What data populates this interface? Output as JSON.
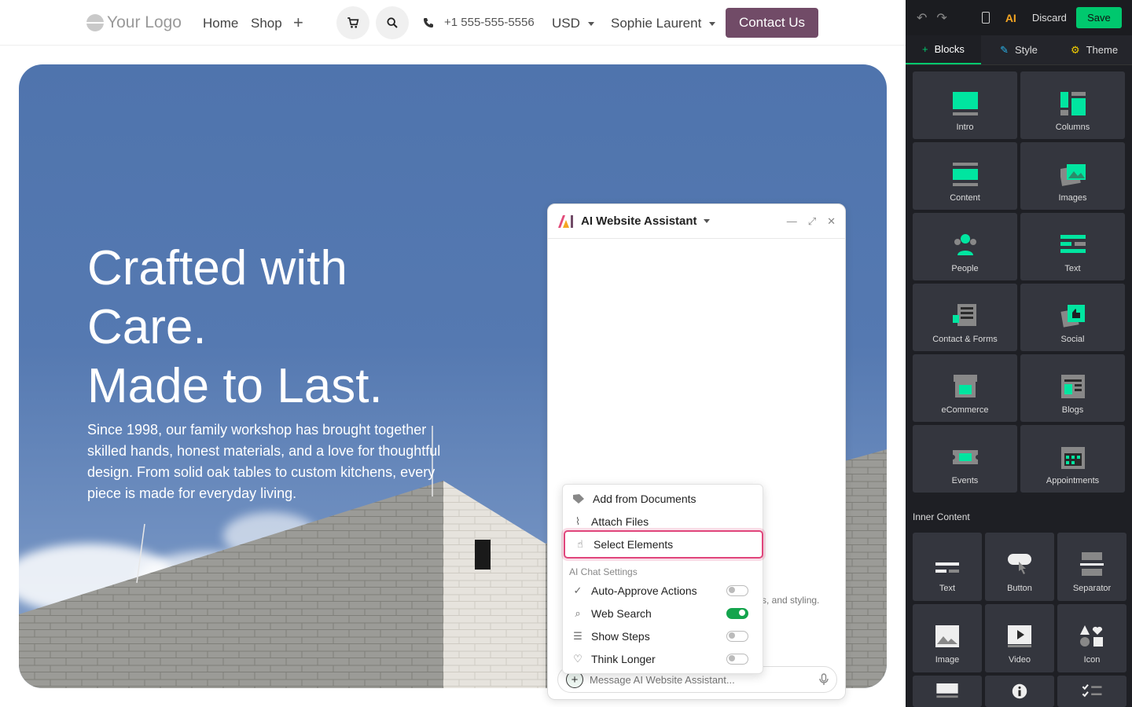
{
  "header": {
    "logo_text": "Your Logo",
    "nav": [
      "Home",
      "Shop"
    ],
    "phone": "+1 555-555-5556",
    "currency": "USD",
    "user": "Sophie Laurent",
    "contact_label": "Contact Us"
  },
  "hero": {
    "title_line1": "Crafted with",
    "title_line2": "Care.",
    "title_line3": "Made to Last.",
    "subtitle": "Since 1998, our family workshop has brought together skilled hands, honest materials, and a love for thoughtful design. From solid oak tables to custom kitchens, every piece is made for everyday living."
  },
  "assistant": {
    "title": "AI Website Assistant",
    "behind_text": "s, and styling.",
    "input_placeholder": "Message AI Website Assistant...",
    "menu": {
      "items": [
        {
          "label": "Add from Documents",
          "icon": "documents-icon"
        },
        {
          "label": "Attach Files",
          "icon": "paperclip-icon"
        },
        {
          "label": "Select Elements",
          "icon": "hand-pointer-icon",
          "selected": true
        }
      ],
      "settings_heading": "AI Chat Settings",
      "settings": [
        {
          "label": "Auto-Approve Actions",
          "icon": "check-badge-icon",
          "enabled": false
        },
        {
          "label": "Web Search",
          "icon": "search-icon",
          "enabled": true
        },
        {
          "label": "Show Steps",
          "icon": "list-check-icon",
          "enabled": false
        },
        {
          "label": "Think Longer",
          "icon": "lightbulb-icon",
          "enabled": false
        }
      ]
    }
  },
  "sidebar": {
    "discard_label": "Discard",
    "save_label": "Save",
    "ai_label": "AI",
    "tabs": [
      "Blocks",
      "Style",
      "Theme"
    ],
    "blocks": [
      "Intro",
      "Columns",
      "Content",
      "Images",
      "People",
      "Text",
      "Contact & Forms",
      "Social",
      "eCommerce",
      "Blogs",
      "Events",
      "Appointments"
    ],
    "inner_heading": "Inner Content",
    "inner_blocks": [
      "Text",
      "Button",
      "Separator",
      "Image",
      "Video",
      "Icon"
    ]
  },
  "colors": {
    "accent_green": "#00c86e",
    "brand_purple": "#714b67",
    "highlight_pink": "#e0457b",
    "toggle_on": "#14a44d"
  }
}
